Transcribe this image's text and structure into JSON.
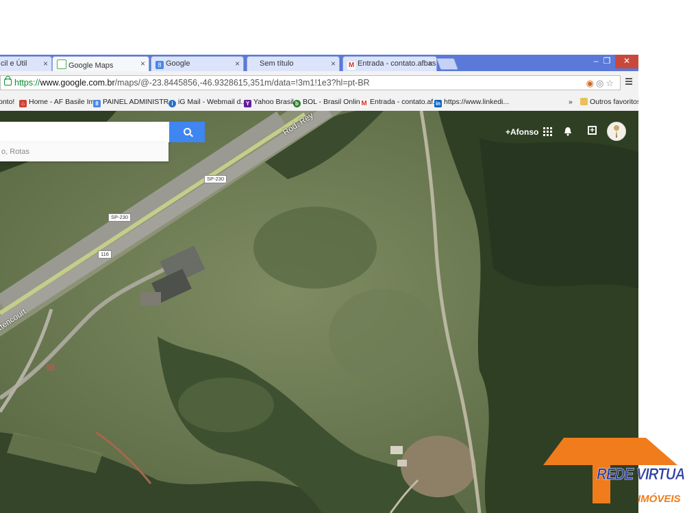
{
  "browser": {
    "tabs": [
      {
        "label": "cil e Útil",
        "favicon_color": "#ffffff"
      },
      {
        "label": "Google Maps",
        "favicon_color": "#4caf50",
        "active": true
      },
      {
        "label": "Google",
        "favicon_color": "#4a86e8"
      },
      {
        "label": "Sem título",
        "favicon_color": "#dbe4fb"
      },
      {
        "label": "Entrada - contato.afbasile",
        "favicon_color": "#ffffff"
      }
    ],
    "window_controls": {
      "minimize": "–",
      "restore": "❐",
      "close": "✕"
    },
    "address_bar": {
      "scheme": "https://",
      "host": "www.google.com.br",
      "path": "/maps/@-23.8445856,-46.9328615,351m/data=!3m1!1e3?hl=pt-BR"
    },
    "bookmarks": [
      {
        "label": "onto!",
        "icon": "none"
      },
      {
        "label": "Home - AF Basile Im...",
        "icon": "home-icon",
        "color": "#d23f31"
      },
      {
        "label": "PAINEL ADMINISTR...",
        "icon": "doc-icon",
        "color": "#4a86e8"
      },
      {
        "label": "iG Mail - Webmail d...",
        "icon": "ig-icon",
        "color": "#2b71c4"
      },
      {
        "label": "Yahoo Brasil",
        "icon": "yahoo-icon",
        "color": "#5f1f9a"
      },
      {
        "label": "BOL - Brasil Online",
        "icon": "bol-icon",
        "color": "#2e7d32"
      },
      {
        "label": "Entrada - contato.af...",
        "icon": "gmail-icon",
        "color": "#d93025"
      },
      {
        "label": "https://www.linkedi...",
        "icon": "linkedin-icon",
        "color": "#0a66c2"
      }
    ],
    "bookmarks_overflow": "»",
    "other_bookmarks": "Outros favoritos"
  },
  "maps": {
    "search_value": "",
    "suggestion_text": "o, Rotas",
    "user_link": "+Afonso",
    "road_labels": {
      "road_name_top": "Rod. Rey",
      "road_name_left": "ttencourt"
    },
    "shields": [
      "SP-230",
      "SP-230",
      "116"
    ],
    "accent": "#3f86f2"
  },
  "watermark": {
    "brand": "REDE VIRTUA",
    "subtitle": "IMÓVEIS",
    "roof_color": "#f07c1c",
    "text_color": "#2c3ea3"
  }
}
